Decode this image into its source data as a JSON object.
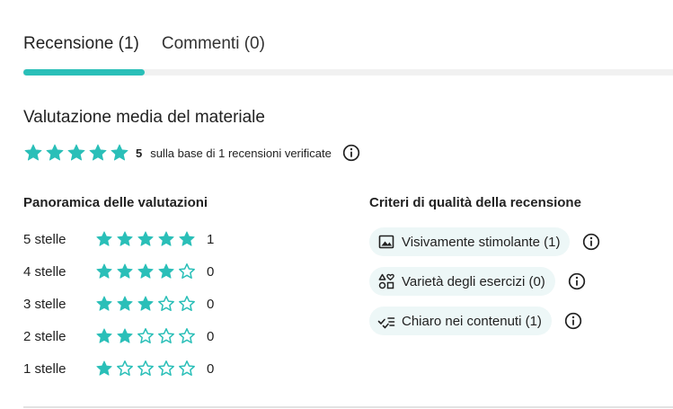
{
  "tabs": [
    {
      "label": "Recensione (1)",
      "active": true
    },
    {
      "label": "Commenti (0)",
      "active": false
    }
  ],
  "summary": {
    "title": "Valutazione media del materiale",
    "average": "5",
    "average_stars": 5,
    "description": "sulla base di 1 recensioni verificate"
  },
  "overview": {
    "title": "Panoramica delle valutazioni",
    "rows": [
      {
        "label": "5 stelle",
        "stars": 5,
        "count": "1"
      },
      {
        "label": "4 stelle",
        "stars": 4,
        "count": "0"
      },
      {
        "label": "3 stelle",
        "stars": 3,
        "count": "0"
      },
      {
        "label": "2 stelle",
        "stars": 2,
        "count": "0"
      },
      {
        "label": "1 stelle",
        "stars": 1,
        "count": "0"
      }
    ]
  },
  "criteria": {
    "title": "Criteri di qualità della recensione",
    "items": [
      {
        "label": "Visivamente stimolante (1)",
        "icon": "image-icon"
      },
      {
        "label": "Varietà degli esercizi (0)",
        "icon": "shapes-icon"
      },
      {
        "label": "Chiaro nei contenuti (1)",
        "icon": "checklist-icon"
      }
    ]
  },
  "colors": {
    "accent": "#2abfb8",
    "chip_bg": "#edf7f7",
    "track": "#f1f1f1"
  }
}
